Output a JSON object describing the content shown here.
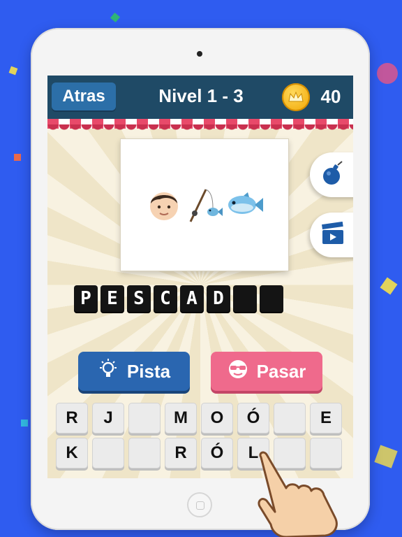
{
  "header": {
    "back_label": "Atras",
    "level_title": "Nivel 1 - 3",
    "coins": "40",
    "coin_icon": "crown-coin-icon"
  },
  "puzzle": {
    "emojis": [
      "boy-emoji",
      "fishing-pole-emoji",
      "fish-emoji"
    ]
  },
  "side_buttons": [
    {
      "icon": "bomb-icon"
    },
    {
      "icon": "clapperboard-icon"
    }
  ],
  "answer": {
    "letters": [
      "P",
      "E",
      "S",
      "C",
      "A",
      "D",
      "",
      ""
    ]
  },
  "actions": {
    "hint_label": "Pista",
    "hint_icon": "lightbulb-icon",
    "skip_label": "Pasar",
    "skip_icon": "sunglasses-face-icon"
  },
  "keyboard": {
    "keys": [
      "R",
      "J",
      "",
      "M",
      "O",
      "Ó",
      "",
      "E",
      "K",
      "",
      "",
      "R",
      "Ó",
      "L",
      "",
      ""
    ]
  },
  "colors": {
    "background": "#2f5cf0",
    "header": "#1f4a66",
    "hint_button": "#2a66b0",
    "skip_button": "#ef6a8c",
    "answer_tile": "#141414"
  }
}
